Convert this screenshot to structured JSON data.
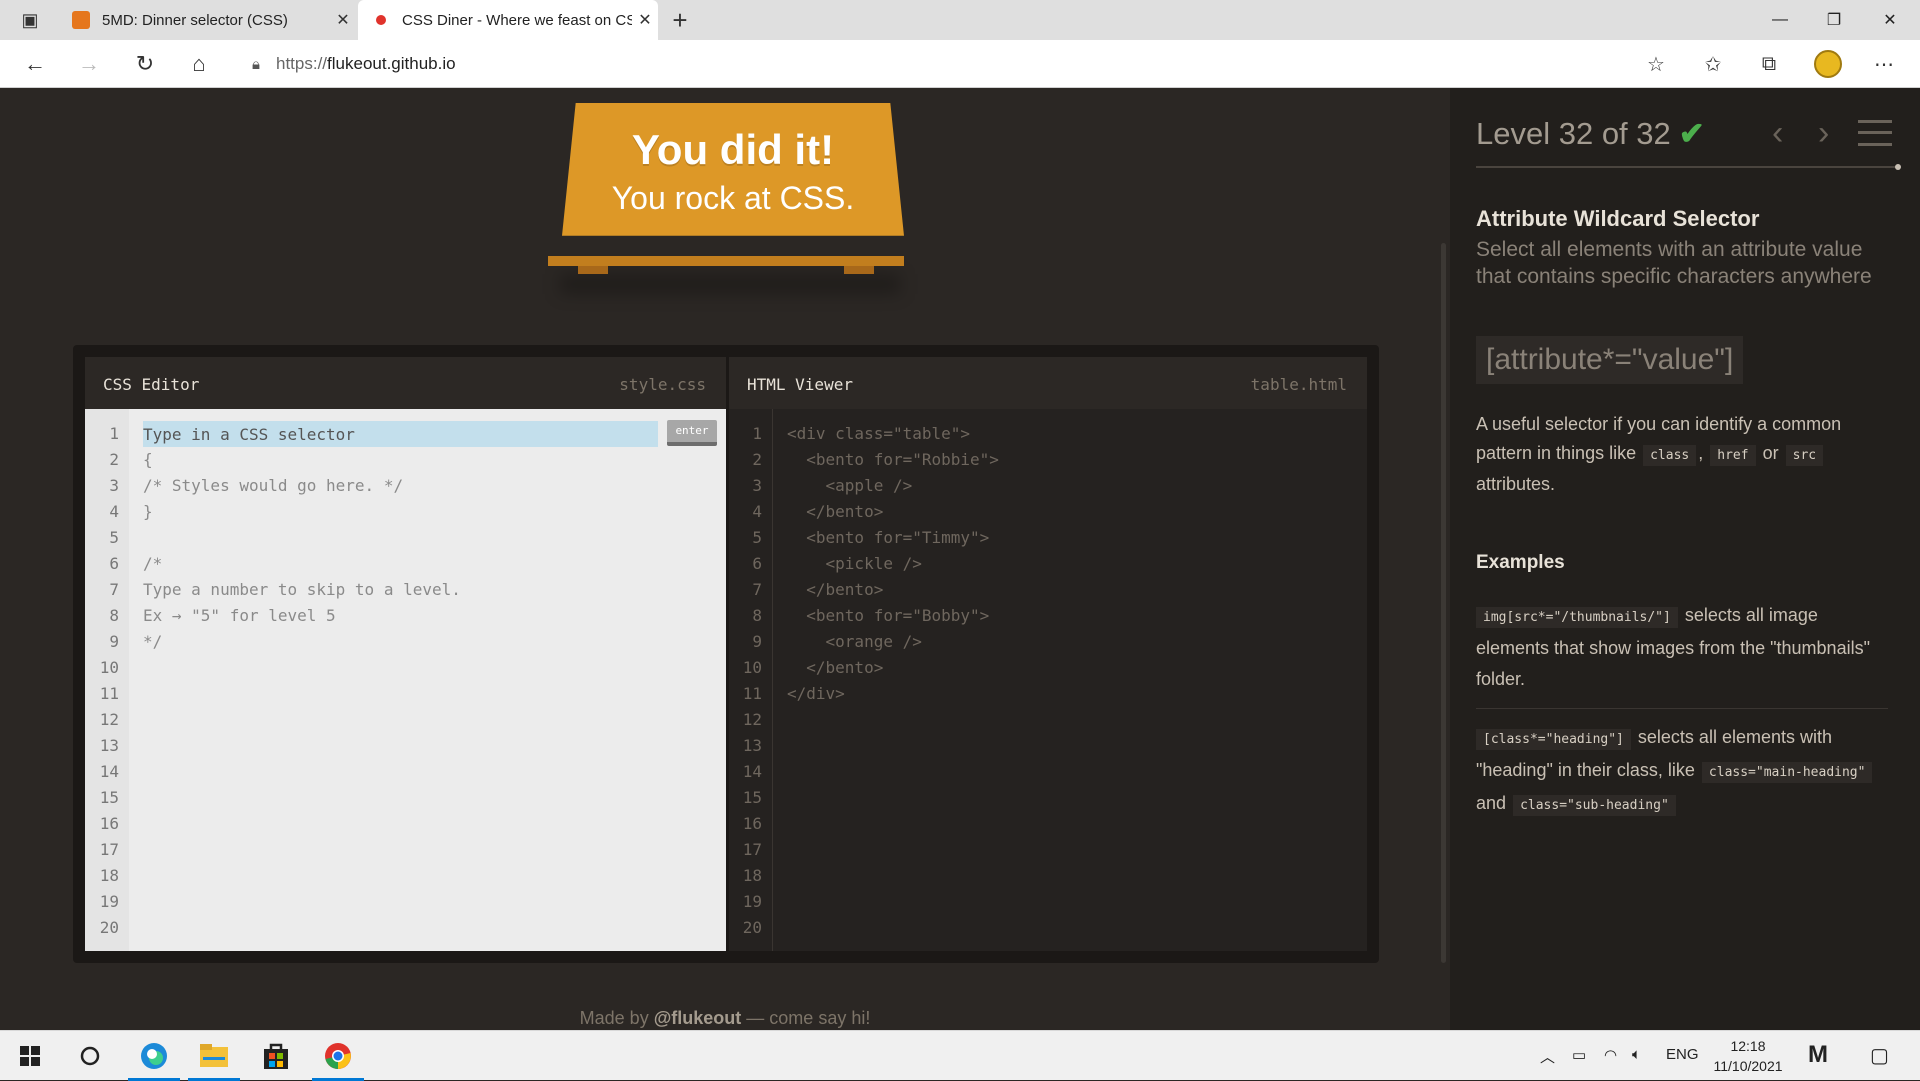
{
  "browser": {
    "tabs": [
      {
        "title": "5MD: Dinner selector (CSS)",
        "favicon_color": "#e5761c",
        "active": false
      },
      {
        "title": "CSS Diner - Where we feast on CSS Selectors!",
        "favicon_color": "#e0332c",
        "active": true
      }
    ],
    "new_tab_label": "+",
    "url_prefix": "https://",
    "url_host": "flukeout.github.io"
  },
  "page": {
    "win_title": "You did it!",
    "win_subtitle": "You rock at CSS.",
    "css_editor": {
      "title": "CSS Editor",
      "filename": "style.css",
      "input_placeholder": "Type in a CSS selector",
      "enter_label": "enter",
      "line_numbers": [
        "1",
        "2",
        "3",
        "4",
        "5",
        "6",
        "7",
        "8",
        "9",
        "10",
        "11",
        "12",
        "13",
        "14",
        "15",
        "16",
        "17",
        "18",
        "19",
        "20"
      ],
      "code_lines": [
        "{",
        "/* Styles would go here. */",
        "}",
        "",
        "/*",
        "Type a number to skip to a level.",
        "Ex → \"5\" for level 5",
        "*/"
      ]
    },
    "html_viewer": {
      "title": "HTML Viewer",
      "filename": "table.html",
      "line_numbers": [
        "1",
        "2",
        "3",
        "4",
        "5",
        "6",
        "7",
        "8",
        "9",
        "10",
        "11",
        "12",
        "13",
        "14",
        "15",
        "16",
        "17",
        "18",
        "19",
        "20"
      ],
      "code_lines": [
        "<div class=\"table\">",
        "  <bento for=\"Robbie\">",
        "    <apple />",
        "  </bento>",
        "  <bento for=\"Timmy\">",
        "    <pickle />",
        "  </bento>",
        "  <bento for=\"Bobby\">",
        "    <orange />",
        "  </bento>",
        "</div>"
      ]
    },
    "footer": {
      "prefix": "Made by",
      "handle": "@flukeout",
      "suffix": "— come say hi!"
    }
  },
  "sidebar": {
    "level_text": "Level 32 of 32",
    "level_check": "✔",
    "selector_title": "Attribute Wildcard Selector",
    "selector_desc": "Select all elements with an attribute value that contains specific characters anywhere",
    "syntax": "[attribute*=\"value\"]",
    "hint": {
      "part1": "A useful selector if you can identify a common pattern in things like",
      "code1": "class",
      "sep": ",",
      "code2": "href",
      "or": "or",
      "code3": "src",
      "part2": "attributes."
    },
    "examples_heading": "Examples",
    "example1": {
      "code": "img[src*=\"/thumbnails/\"]",
      "text": "selects all image elements that show images from the \"thumbnails\" folder."
    },
    "example2": {
      "code": "[class*=\"heading\"]",
      "text1": "selects all elements with \"heading\" in their class, like",
      "code_a": "class=\"main-heading\"",
      "and": "and",
      "code_b": "class=\"sub-heading\""
    }
  },
  "taskbar": {
    "language": "ENG",
    "time": "12:18",
    "date": "11/10/2021"
  },
  "colors": {
    "table": "#dd9827",
    "check": "#4cae4c",
    "accent": "#0078d4"
  }
}
